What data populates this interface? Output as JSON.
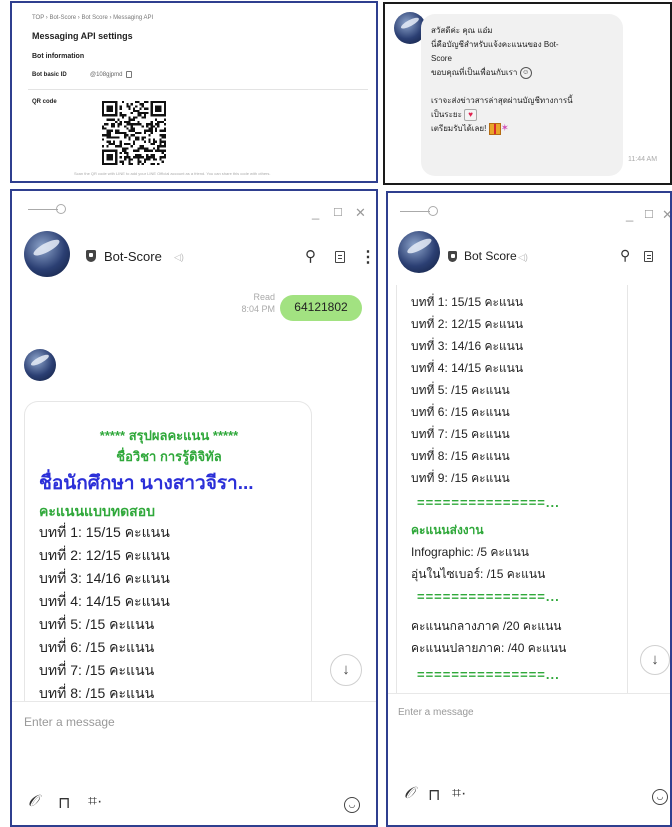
{
  "console": {
    "breadcrumb": "TOP  ›  Bot-Score  ›  Bot Score  ›  Messaging API",
    "title": "Messaging API settings",
    "section": "Bot information",
    "bot_id_label": "Bot basic ID",
    "bot_id_value": "@108gjpmd",
    "qr_label": "QR code",
    "qr_note": "Scan the QR code with LINE to add your LINE Official account as a friend. You can share this code with others."
  },
  "greeting": {
    "lines": [
      "สวัสดีค่ะ คุณ แอ๋ม",
      "นี่คือบัญชีสำหรับแจ้งคะแนนของ Bot-",
      "Score",
      "ขอบคุณที่เป็นเพื่อนกับเรา",
      "",
      "เราจะส่งข่าวสารล่าสุดผ่านบัญชีทางการนี้",
      "เป็นระยะ",
      "เตรียมรับได้เลย!"
    ],
    "time": "11:44 AM"
  },
  "chat_left": {
    "bot_name": "Bot-Score",
    "sent_message": "64121802",
    "read_label": "Read",
    "sent_time": "8:04 PM",
    "summary_title": "***** สรุปผลคะแนน *****",
    "subject": "ชื่อวิชา การรู้ดิจิทัล",
    "student": "ชื่อนักศึกษา นางสาวจีรา...",
    "test_header": "คะแนนแบบทดสอบ",
    "scores": [
      "บทที่ 1: 15/15 คะแนน",
      "บทที่ 2: 12/15 คะแนน",
      "บทที่ 3: 14/16 คะแนน",
      "บทที่ 4: 14/15 คะแนน",
      "บทที่ 5: /15 คะแนน",
      "บทที่ 6: /15 คะแนน",
      "บทที่ 7: /15 คะแนน",
      "บทที่ 8: /15 คะแนน"
    ],
    "input_placeholder": "Enter a message"
  },
  "chat_right": {
    "bot_name": "Bot Score",
    "scores": [
      "บทที่ 1: 15/15 คะแนน",
      "บทที่ 2: 12/15 คะแนน",
      "บทที่ 3: 14/16 คะแนน",
      "บทที่ 4: 14/15 คะแนน",
      "บทที่ 5: /15 คะแนน",
      "บทที่ 6: /15 คะแนน",
      "บทที่ 7: /15 คะแนน",
      "บทที่ 8: /15 คะแนน",
      "บทที่ 9: /15 คะแนน"
    ],
    "divider": "===============...",
    "assignment_header": "คะแนนส่งงาน",
    "assignments": [
      "Infographic: /5 คะแนน",
      "อุ่นในไซเบอร์: /15 คะแนน"
    ],
    "exams": [
      "คะแนนกลางภาค /20 คะแนน",
      "คะแนนปลายภาค: /40 คะแนน"
    ],
    "input_placeholder": "Enter a message"
  },
  "glyphs": {
    "minimize": "_",
    "maximize": "☐",
    "close": "✕",
    "search": "⚲",
    "more": "⋮",
    "speaker": "◁)",
    "scroll_down": "↓",
    "attach": "𝒪",
    "bookmark": "⊓",
    "crop": "⌗·",
    "emoji": "◡"
  }
}
